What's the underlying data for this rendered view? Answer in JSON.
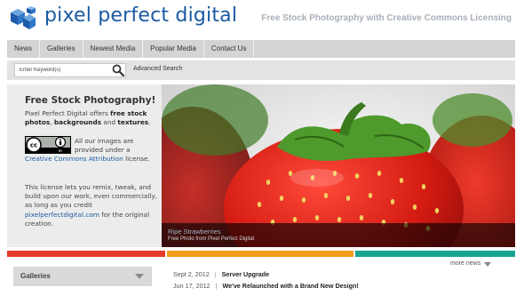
{
  "header": {
    "brand": "pixel perfect digital",
    "tagline": "Free Stock Photography with Creative Commons Licensing",
    "logo_icon": "cubes-logo-icon",
    "brand_color": "#1a5aa3"
  },
  "nav": {
    "items": [
      {
        "label": "News"
      },
      {
        "label": "Galleries"
      },
      {
        "label": "Newest Media"
      },
      {
        "label": "Popular Media"
      },
      {
        "label": "Contact Us"
      }
    ]
  },
  "search": {
    "placeholder": "Enter Keyword(s)",
    "button_icon": "search-icon",
    "advanced_label": "Advanced Search"
  },
  "sidebar": {
    "title": "Free Stock Photography!",
    "intro_pre": "Pixel Perfect Digital offers ",
    "intro_bold1": "free stock photos",
    "intro_mid": ", ",
    "intro_bold2": "backgrounds",
    "intro_and": " and ",
    "intro_bold3": "textures",
    "intro_end": ".",
    "cc_icon": "creative-commons-by-badge",
    "cc_text_1": "All our images are provided under a ",
    "cc_link": "Creative Commons Attribution",
    "cc_text_2": " license.",
    "license_text": "This license lets you remix, tweak, and build upon our work, even commercially, as long as you credit ",
    "credit_link": "pixelperfectdigital.com",
    "license_end": " for the original creation."
  },
  "hero": {
    "caption_title": "Ripe Strawberries",
    "caption_sub": "Free Photo from Pixel Perfect Digital"
  },
  "colors": {
    "red": "#e83a2c",
    "orange": "#f39c1a",
    "teal": "#16a591"
  },
  "galleries": {
    "label": "Galleries",
    "arrow_icon": "chevron-down-icon"
  },
  "news": {
    "more_label": "more news",
    "items": [
      {
        "date": "Sept 2, 2012",
        "title": "Server Upgrade"
      },
      {
        "date": "Jun 17, 2012",
        "title": "We've Relaunched with a Brand New Design!"
      }
    ]
  }
}
